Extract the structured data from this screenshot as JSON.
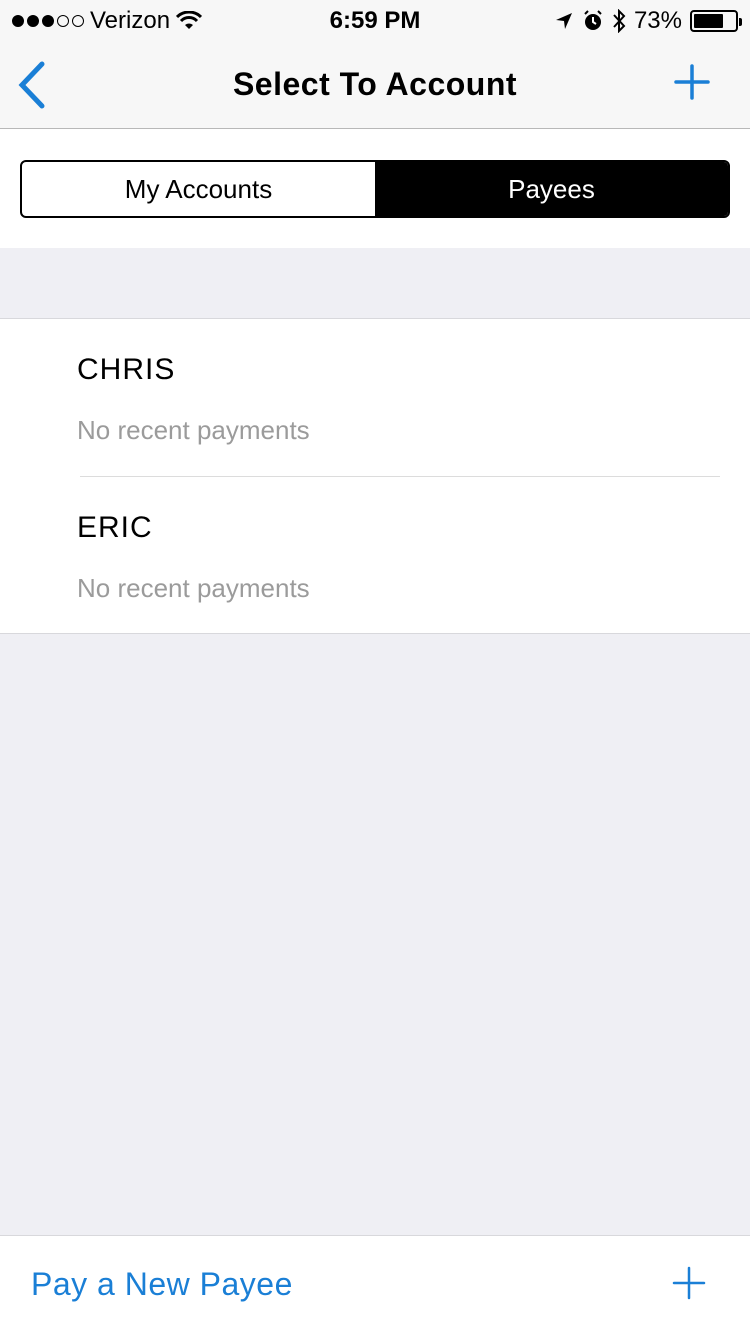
{
  "status_bar": {
    "carrier": "Verizon",
    "time": "6:59 PM",
    "battery_percent": "73%",
    "battery_level": 0.73,
    "signal_strength": 3,
    "signal_max": 5,
    "icons": [
      "wifi-icon",
      "location-icon",
      "alarm-icon",
      "bluetooth-icon"
    ]
  },
  "nav": {
    "title": "Select To Account",
    "back_icon": "chevron-left-icon",
    "add_icon": "plus-icon",
    "accent_color": "#1a7fd6"
  },
  "segments": [
    {
      "label": "My Accounts",
      "selected": false
    },
    {
      "label": "Payees",
      "selected": true
    }
  ],
  "payees": [
    {
      "name": "CHRIS",
      "status": "No recent payments"
    },
    {
      "name": "ERIC",
      "status": "No recent payments"
    }
  ],
  "footer": {
    "label": "Pay a New Payee",
    "add_icon": "plus-icon"
  }
}
